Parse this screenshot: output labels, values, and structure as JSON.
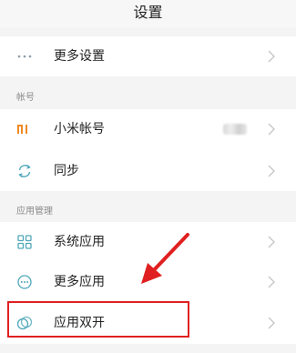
{
  "header": {
    "title": "设置"
  },
  "top_group": {
    "items": [
      {
        "label": "更多设置",
        "icon": "more-horizontal-icon"
      }
    ]
  },
  "account_section": {
    "label": "帐号",
    "items": [
      {
        "label": "小米帐号",
        "icon": "mi-logo-icon"
      },
      {
        "label": "同步",
        "icon": "sync-icon"
      }
    ]
  },
  "app_management": {
    "label": "应用管理",
    "items": [
      {
        "label": "系统应用",
        "icon": "grid-apps-icon"
      },
      {
        "label": "更多应用",
        "icon": "more-circle-icon"
      },
      {
        "label": "应用双开",
        "icon": "dual-apps-icon"
      }
    ]
  },
  "colors": {
    "accent_orange": "#f08a24",
    "annotation_red": "#e02020",
    "icon_teal": "#4fa7b9"
  }
}
